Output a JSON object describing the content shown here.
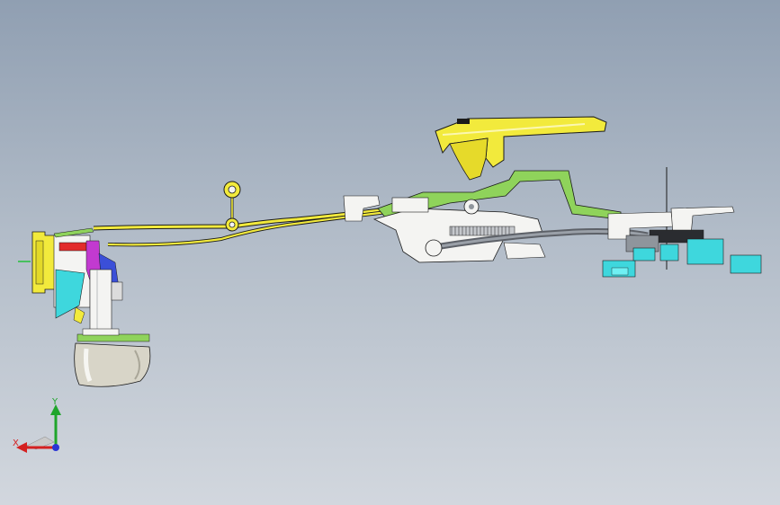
{
  "viewport": {
    "background_top": "#909fb2",
    "background_bottom": "#d2d7de"
  },
  "colors": {
    "yellow": "#f2ea3c",
    "yellow_dark": "#b7ab11",
    "green": "#8fd35b",
    "cyan": "#3ed7dd",
    "magenta": "#c23ad0",
    "red": "#e22b2b",
    "blue": "#3b4fd8",
    "grey_part": "#8f959c",
    "white_part": "#f4f4f2",
    "outline": "#1b1b1b"
  },
  "triad": {
    "x_label": "X",
    "y_label": "Y",
    "x_color": "#d42020",
    "y_color": "#1fa52b",
    "z_color": "#2a34d4",
    "icon": "axis-triad-icon"
  },
  "parts": [
    {
      "name": "actuator-assembly",
      "icon": "latch-actuator-icon"
    },
    {
      "name": "rod-linkage",
      "icon": "rod-icon"
    },
    {
      "name": "handle-assembly",
      "icon": "door-handle-icon"
    },
    {
      "name": "cable-assembly",
      "icon": "cable-icon"
    },
    {
      "name": "connector-cluster",
      "icon": "connector-icon"
    }
  ]
}
